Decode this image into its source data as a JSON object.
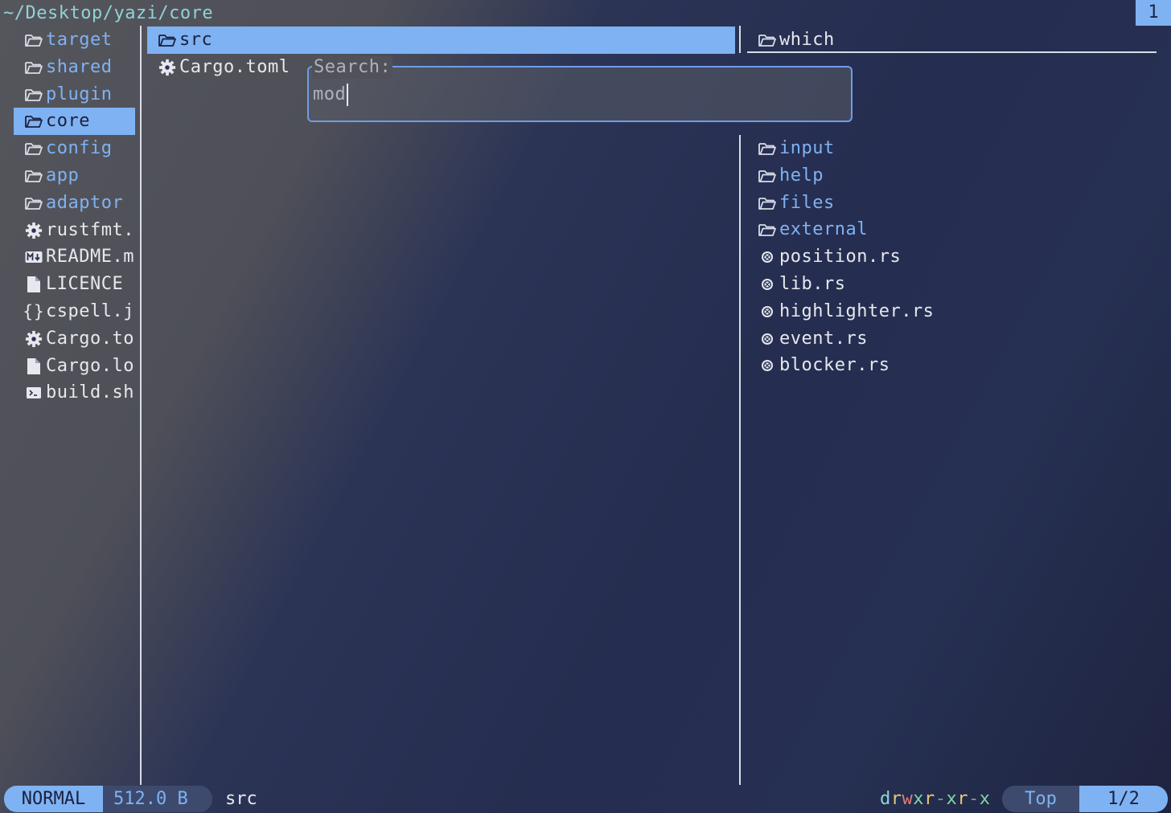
{
  "header": {
    "path": "~/Desktop/yazi/core",
    "tab_number": "1"
  },
  "parent_pane": {
    "items": [
      {
        "name": "target",
        "type": "dir",
        "icon": "folder-icon"
      },
      {
        "name": "shared",
        "type": "dir",
        "icon": "folder-icon"
      },
      {
        "name": "plugin",
        "type": "dir",
        "icon": "folder-icon"
      },
      {
        "name": "core",
        "type": "dir",
        "icon": "folder-icon",
        "selected": true
      },
      {
        "name": "config",
        "type": "dir",
        "icon": "folder-icon"
      },
      {
        "name": "app",
        "type": "dir",
        "icon": "folder-icon"
      },
      {
        "name": "adaptor",
        "type": "dir",
        "icon": "folder-icon"
      },
      {
        "name": "rustfmt.",
        "type": "file",
        "icon": "gear-icon"
      },
      {
        "name": "README.m",
        "type": "file",
        "icon": "markdown-icon"
      },
      {
        "name": "LICENCE",
        "type": "file",
        "icon": "file-icon"
      },
      {
        "name": "cspell.j",
        "type": "file",
        "icon": "json-icon"
      },
      {
        "name": "Cargo.to",
        "type": "file",
        "icon": "gear-icon"
      },
      {
        "name": "Cargo.lo",
        "type": "file",
        "icon": "file-icon"
      },
      {
        "name": "build.sh",
        "type": "file",
        "icon": "terminal-icon"
      }
    ]
  },
  "current_pane": {
    "items": [
      {
        "name": "src",
        "type": "dir",
        "icon": "folder-icon",
        "selected": true
      },
      {
        "name": "Cargo.toml",
        "type": "file",
        "icon": "gear-icon"
      }
    ]
  },
  "preview_pane": {
    "header": "which",
    "items": [
      {
        "name": "input",
        "type": "dir",
        "icon": "folder-icon"
      },
      {
        "name": "help",
        "type": "dir",
        "icon": "folder-icon"
      },
      {
        "name": "files",
        "type": "dir",
        "icon": "folder-icon"
      },
      {
        "name": "external",
        "type": "dir",
        "icon": "folder-icon"
      },
      {
        "name": "position.rs",
        "type": "file",
        "icon": "rust-icon"
      },
      {
        "name": "lib.rs",
        "type": "file",
        "icon": "rust-icon"
      },
      {
        "name": "highlighter.rs",
        "type": "file",
        "icon": "rust-icon"
      },
      {
        "name": "event.rs",
        "type": "file",
        "icon": "rust-icon"
      },
      {
        "name": "blocker.rs",
        "type": "file",
        "icon": "rust-icon"
      }
    ]
  },
  "search": {
    "title": "Search:",
    "value": "mod"
  },
  "status_bar": {
    "mode": "NORMAL",
    "size": "512.0 B",
    "hovered": "src",
    "permissions": [
      {
        "ch": "d",
        "color": "#8fd3d8"
      },
      {
        "ch": "r",
        "color": "#e6c87a"
      },
      {
        "ch": "w",
        "color": "#e07a7a"
      },
      {
        "ch": "x",
        "color": "#7ed8a0"
      },
      {
        "ch": "r",
        "color": "#e6c87a"
      },
      {
        "ch": "-",
        "color": "#8a8fa8"
      },
      {
        "ch": "x",
        "color": "#7ed8a0"
      },
      {
        "ch": "r",
        "color": "#e6c87a"
      },
      {
        "ch": "-",
        "color": "#8a8fa8"
      },
      {
        "ch": "x",
        "color": "#7ed8a0"
      }
    ],
    "position_label": "Top",
    "page": "1/2"
  },
  "colors": {
    "accent": "#7fb2f2",
    "directory": "#7fb2f2",
    "selection_text": "#1a2140"
  }
}
